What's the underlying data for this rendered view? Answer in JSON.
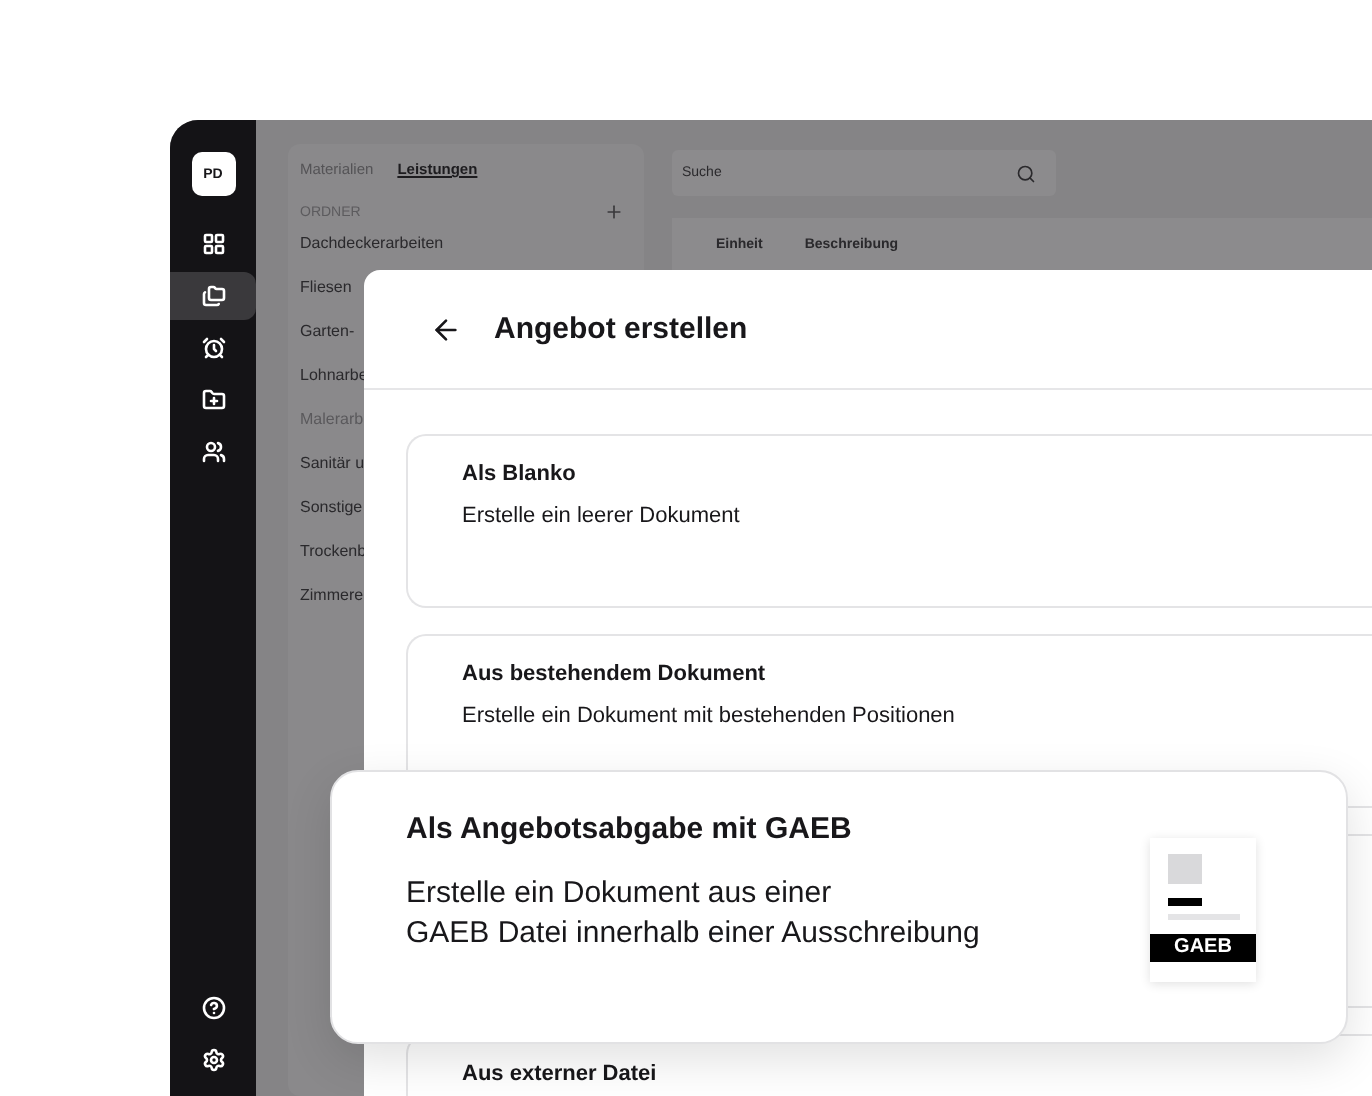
{
  "sidebar": {
    "avatar": "PD",
    "items": [
      {
        "selected": false
      },
      {
        "selected": true
      },
      {
        "selected": false
      },
      {
        "selected": false
      },
      {
        "selected": false
      }
    ],
    "bottom_items": [
      {
        "selected": false
      },
      {
        "selected": false
      }
    ]
  },
  "library": {
    "tabs": [
      {
        "label": "Materialien",
        "selected": false
      },
      {
        "label": "Leistungen",
        "selected": true
      }
    ],
    "section": "ORDNER",
    "folders": [
      {
        "label": "Dachdeckerarbeiten",
        "disabled": false
      },
      {
        "label": "Fliesen",
        "disabled": false
      },
      {
        "label": "Garten-",
        "disabled": false
      },
      {
        "label": "Lohnarbe",
        "disabled": false
      },
      {
        "label": "Malerarb",
        "disabled": true
      },
      {
        "label": "Sanitär u",
        "disabled": false
      },
      {
        "label": "Sonstige",
        "disabled": false
      },
      {
        "label": "Trockenb",
        "disabled": false
      },
      {
        "label": "Zimmere",
        "disabled": false
      }
    ]
  },
  "search": {
    "placeholder": "Suche"
  },
  "table": {
    "columns": [
      "Einheit",
      "Beschreibung"
    ]
  },
  "modal": {
    "title": "Angebot erstellen",
    "options": [
      {
        "title": "Als Blanko",
        "description": "Erstelle ein leerer Dokument",
        "highlighted": false
      },
      {
        "title": "Aus bestehendem Dokument",
        "description": "Erstelle ein Dokument mit bestehenden Positionen",
        "highlighted": false
      },
      {
        "title": "Als Angebotsabgabe mit GAEB",
        "description": "Erstelle ein Dokument aus einer\nGAEB Datei innerhalb einer Ausschreibung",
        "highlighted": true,
        "badge": "GAEB"
      },
      {
        "title": "Aus externer Datei",
        "highlighted": false
      }
    ]
  }
}
